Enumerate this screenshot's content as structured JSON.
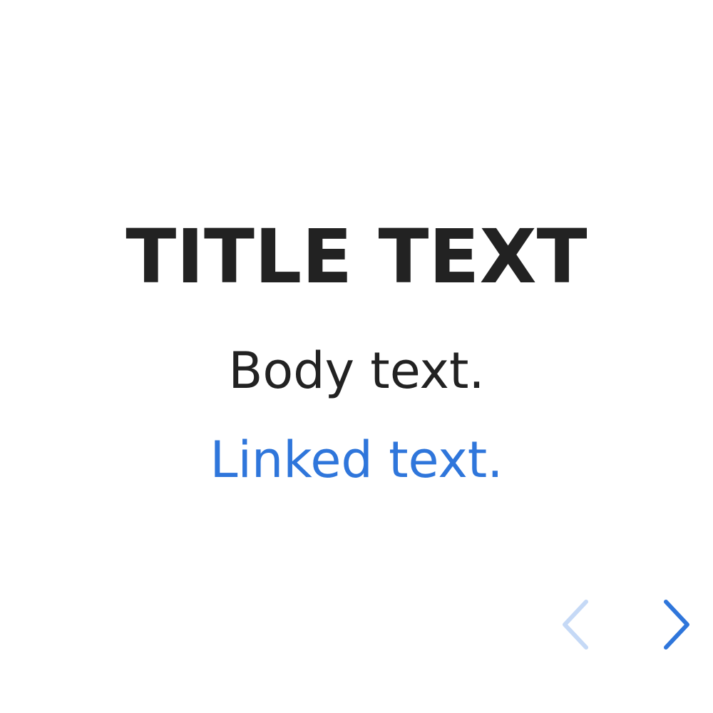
{
  "title": "TITLE TEXT",
  "body_text": "Body text.",
  "link_text": "Linked text.",
  "nav": {
    "prev_icon": "chevron-left-icon",
    "next_icon": "chevron-right-icon",
    "prev_color": "#c5d9f6",
    "next_color": "#2f76db",
    "prev_enabled": false,
    "next_enabled": true
  },
  "colors": {
    "text": "#222222",
    "link": "#2f76db",
    "background": "#ffffff"
  }
}
